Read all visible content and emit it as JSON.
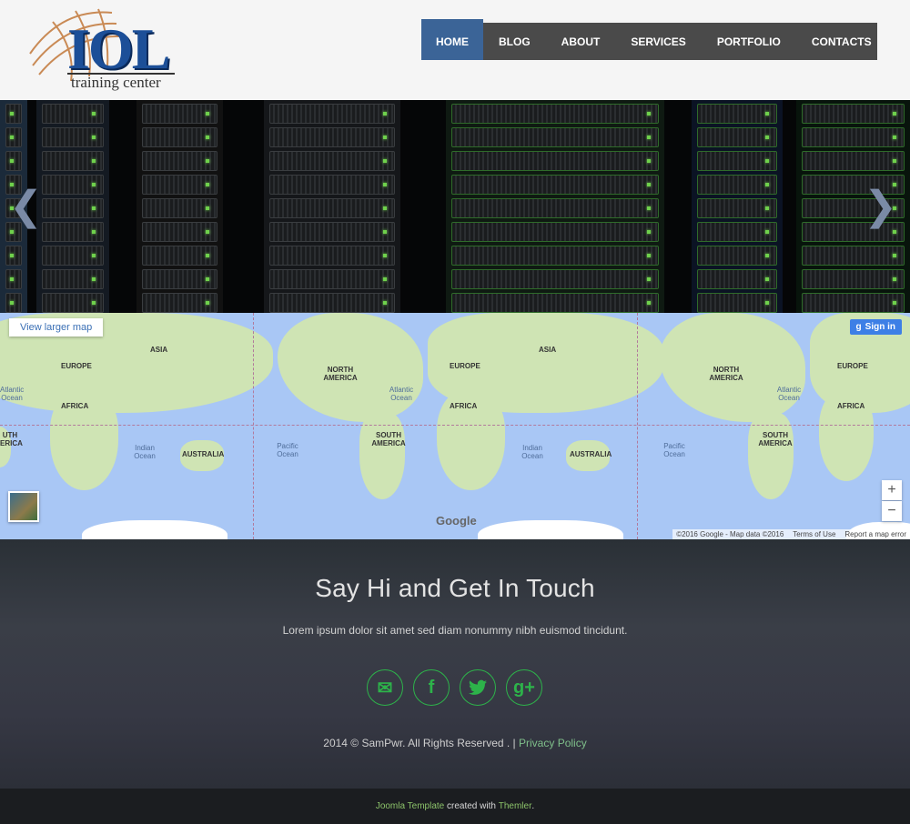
{
  "logo": {
    "text": "IOL",
    "subtitle": "training center"
  },
  "nav": {
    "items": [
      {
        "label": "HOME",
        "active": true
      },
      {
        "label": "BLOG",
        "active": false
      },
      {
        "label": "ABOUT",
        "active": false
      },
      {
        "label": "SERVICES",
        "active": false
      },
      {
        "label": "PORTFOLIO",
        "active": false
      },
      {
        "label": "CONTACTS",
        "active": false
      }
    ]
  },
  "slider": {
    "prev_icon": "chevron-left-icon",
    "next_icon": "chevron-right-icon",
    "prev_glyph": "❮",
    "next_glyph": "❯"
  },
  "map": {
    "view_larger": "View larger map",
    "sign_in": "Sign in",
    "sign_in_glyph": "g",
    "zoom_in": "+",
    "zoom_out": "−",
    "google": "Google",
    "attribution": "©2016 Google - Map data ©2016",
    "terms": "Terms of Use",
    "report": "Report a map error",
    "labels": {
      "asia1": "ASIA",
      "europe1": "EUROPE",
      "africa1": "AFRICA",
      "australia1": "AUSTRALIA",
      "indian1": "Indian Ocean",
      "atlantic_left": "Atlantic Ocean",
      "north_america": "NORTH AMERICA",
      "atlantic1": "Atlantic Ocean",
      "south_america": "SOUTH AMERICA",
      "pacific1": "Pacific Ocean",
      "europe2": "EUROPE",
      "asia2": "ASIA",
      "africa2": "AFRICA",
      "indian2": "Indian Ocean",
      "australia2": "AUSTRALIA",
      "pacific2": "Pacific Ocean",
      "north_america2": "NORTH AMERICA",
      "atlantic2": "Atlantic Ocean",
      "south_america2": "SOUTH AMERICA",
      "europe3": "EUROPE",
      "africa3": "AFRICA",
      "south_edge": "UTH ERICA"
    }
  },
  "contact": {
    "title": "Say Hi and Get In Touch",
    "text": "Lorem ipsum dolor sit amet sed diam nonummy nibh euismod tincidunt.",
    "socials": [
      {
        "icon": "envelope-icon",
        "glyph": "✉"
      },
      {
        "icon": "facebook-icon",
        "glyph": "f"
      },
      {
        "icon": "twitter-icon",
        "glyph": "🐦"
      },
      {
        "icon": "google-plus-icon",
        "glyph": "g+"
      }
    ],
    "copyright": "2014 © SamPwr. All Rights Reserved . |",
    "privacy": "Privacy Policy"
  },
  "footer": {
    "joomla": "Joomla Template",
    "created": " created with ",
    "themler": "Themler",
    "period": "."
  }
}
